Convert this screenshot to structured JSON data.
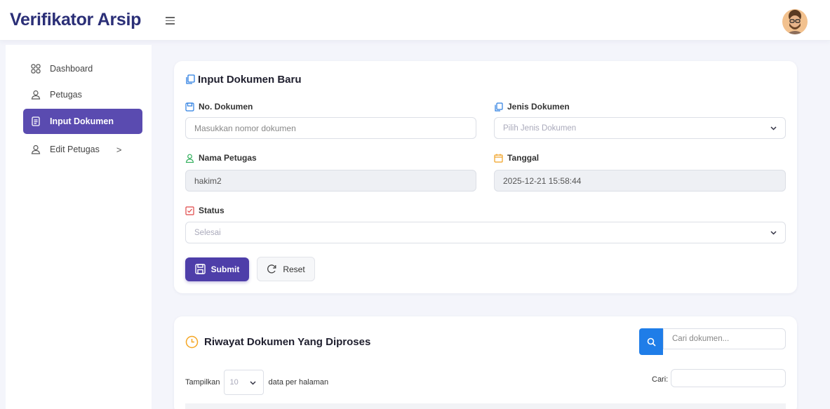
{
  "app": {
    "title": "Verifikator Arsip"
  },
  "sidebar": {
    "items": [
      {
        "label": "Dashboard",
        "icon": "grid-icon"
      },
      {
        "label": "Petugas",
        "icon": "user-icon"
      },
      {
        "label": "Input Dokumen",
        "icon": "document-icon",
        "active": true
      },
      {
        "label": "Edit Petugas",
        "icon": "user-icon",
        "chevron": ">"
      }
    ]
  },
  "form": {
    "title": "Input Dokumen Baru",
    "no_dokumen": {
      "label": "No. Dokumen",
      "placeholder": "Masukkan nomor dokumen"
    },
    "jenis_dokumen": {
      "label": "Jenis Dokumen",
      "value": "Pilih Jenis Dokumen"
    },
    "nama_petugas": {
      "label": "Nama Petugas",
      "value": "hakim2"
    },
    "tanggal": {
      "label": "Tanggal",
      "value": "2025-12-21 15:58:44"
    },
    "status": {
      "label": "Status",
      "value": "Selesai"
    },
    "submit_label": "Submit",
    "reset_label": "Reset"
  },
  "history": {
    "title": "Riwayat Dokumen Yang Diproses",
    "search_placeholder": "Cari dokumen...",
    "show_prefix": "Tampilkan",
    "page_length": "10",
    "show_suffix": "data per halaman",
    "cari_label": "Cari:"
  },
  "colors": {
    "brand": "#2b2f77",
    "accent": "#4e3ea9",
    "sidebar_active": "#5a4bb0",
    "search_button": "#1f7de8",
    "history_icon": "#f5a623"
  }
}
